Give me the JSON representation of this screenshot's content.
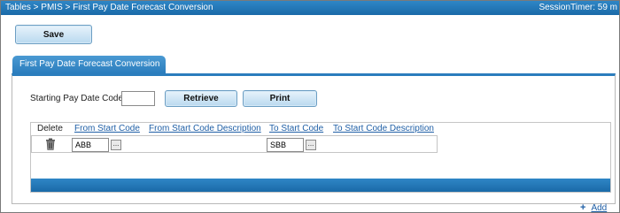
{
  "topbar": {
    "breadcrumb": "Tables > PMIS > First Pay Date Forecast Conversion",
    "session_timer": "SessionTimer: 59 m"
  },
  "toolbar": {
    "save_label": "Save"
  },
  "tab": {
    "label": "First Pay Date Forecast Conversion"
  },
  "form": {
    "starting_code_label": "Starting Pay Date Code:",
    "starting_code_value": "",
    "retrieve_label": "Retrieve",
    "print_label": "Print"
  },
  "grid": {
    "columns": [
      "Delete",
      "From Start Code",
      "From Start Code Description",
      "To Start Code",
      "To Start Code Description"
    ],
    "rows": [
      {
        "from_code": "ABB",
        "to_code": "SBB"
      }
    ],
    "lookup_label": "..."
  },
  "footer": {
    "add_label": "Add",
    "add_icon": "+"
  }
}
